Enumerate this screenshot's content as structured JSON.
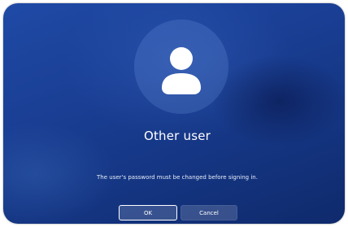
{
  "login": {
    "username": "Other user",
    "message": "The user's password must be changed before signing in.",
    "ok_label": "OK",
    "cancel_label": "Cancel"
  },
  "icons": {
    "avatar": "user-avatar-icon"
  }
}
